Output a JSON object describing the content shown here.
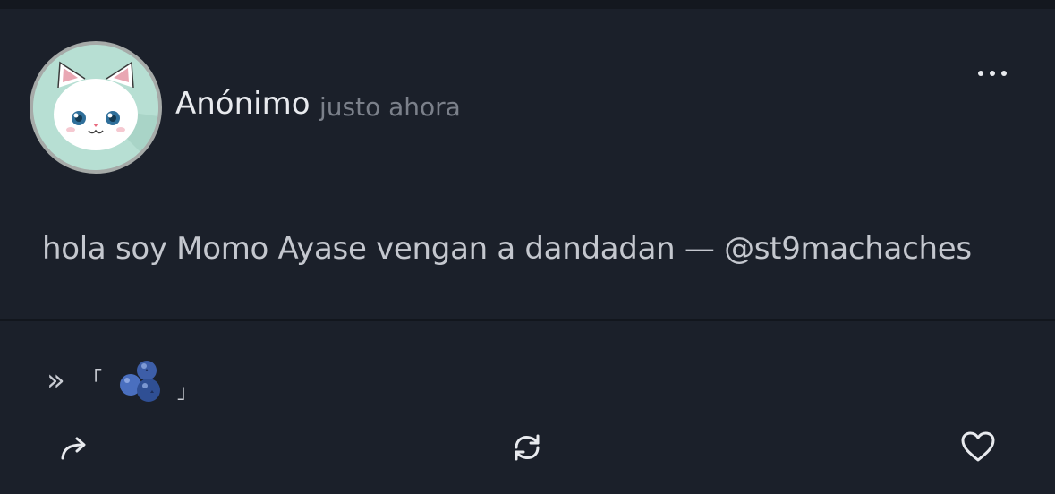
{
  "post": {
    "author": "Anónimo",
    "timestamp": "justo ahora",
    "message": "hola soy Momo Ayase vengan a dandadan — @st9machaches",
    "more_icon": "more-horizontal-icon"
  },
  "tagline": {
    "arrows": "»",
    "open_bracket": "「",
    "emoji": "blueberries",
    "close_bracket": "」"
  },
  "actions": {
    "share_icon": "share-icon",
    "repost_icon": "repost-icon",
    "like_icon": "heart-icon"
  },
  "colors": {
    "background": "#1b202a",
    "avatar_bg": "#b7dfd3",
    "text": "#c4c7ce",
    "muted": "#7b808a"
  }
}
